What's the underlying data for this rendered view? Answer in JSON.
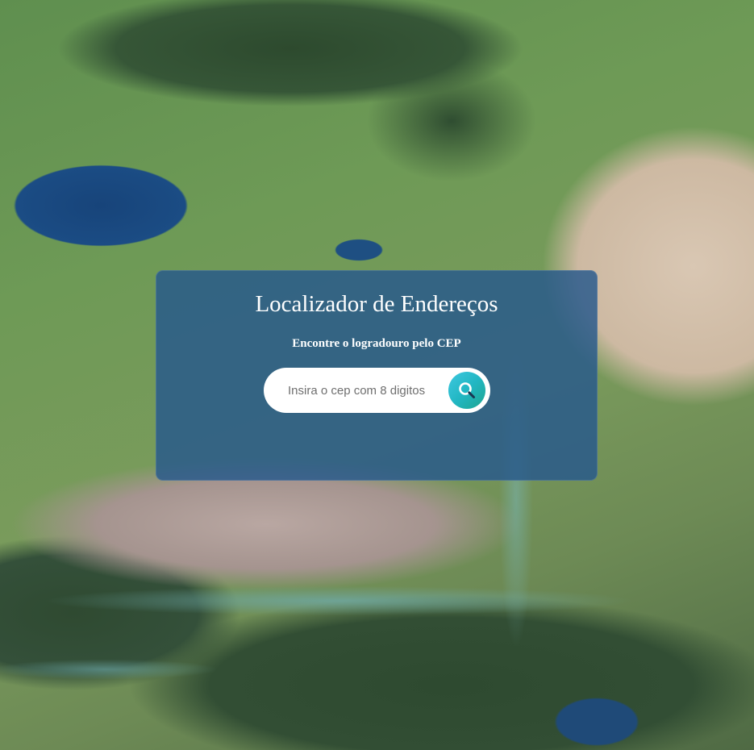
{
  "app": {
    "title": "Localizador de Endereços",
    "subtitle": "Encontre o logradouro pelo CEP"
  },
  "search": {
    "placeholder": "Insira o cep com 8 digitos",
    "value": "",
    "button_icon": "search-icon"
  },
  "colors": {
    "card_background": "#26588c",
    "button_gradient_start": "#3ec8e0",
    "button_gradient_end": "#1fa58f",
    "text": "#ffffff"
  },
  "background": {
    "description_icon": "aerial-landscape-image"
  }
}
